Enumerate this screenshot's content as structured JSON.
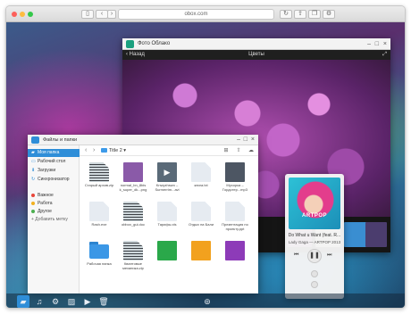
{
  "browser": {
    "url": "obox.com"
  },
  "photo_window": {
    "title": "Фото Облако",
    "back_label": "Назад",
    "folder": "Цветы",
    "thumb_colors": [
      "#a84ea8",
      "#d8c9c2",
      "#3a8ed1",
      "#4b3d6e",
      "#c06fc0"
    ]
  },
  "music": {
    "album_word": "ARTPOP",
    "song": "Do What u Want (feat. R...",
    "artist": "Lady Gaga — ARTPOP 2013"
  },
  "files_window": {
    "title": "Файлы и папки",
    "current_folder": "Title 2",
    "sidebar": [
      {
        "label": "Моя папка",
        "icon": "folder-icon",
        "active": true
      },
      {
        "label": "Рабочий стол",
        "icon": "desktop-icon",
        "active": false
      },
      {
        "label": "Загрузки",
        "icon": "download-icon",
        "active": false
      },
      {
        "label": "Синхронизатор",
        "icon": "sync-icon",
        "active": false
      }
    ],
    "tags": [
      {
        "label": "Важное",
        "color": "#e8463a"
      },
      {
        "label": "Работа",
        "color": "#f2b01e"
      },
      {
        "label": "Другое",
        "color": "#4caf50"
      }
    ],
    "add_tag_label": "+ Добавить метку",
    "files": [
      {
        "name": "Старый архив.zip",
        "kind": "archive",
        "color": "#cfd8dc"
      },
      {
        "name": "normal_bn_8bis k_super_dk...png",
        "kind": "image",
        "color": "#8a5aa8"
      },
      {
        "name": "Knwyzhswn – Surmerrim...avi",
        "kind": "video",
        "color": "#5a6a78"
      },
      {
        "name": "книга.txt",
        "kind": "doc",
        "color": "#e6ebf1"
      },
      {
        "name": "Мусорка – Гордстер...mp3",
        "kind": "photo",
        "color": "#4d5663"
      },
      {
        "name": "Rash.exe",
        "kind": "doc",
        "color": "#e6ebf1"
      },
      {
        "name": "obbox_gui.doc",
        "kind": "archive",
        "color": "#cfd8dc"
      },
      {
        "name": "Тарифы.xls",
        "kind": "doc",
        "color": "#e6ebf1"
      },
      {
        "name": "Отдых на Бали",
        "kind": "doc",
        "color": "#e6ebf1"
      },
      {
        "name": "Презентация по проекту.ppt",
        "kind": "doc",
        "color": "#e6ebf1"
      },
      {
        "name": "Рабочая папка",
        "kind": "folder",
        "color": "#3b97e6"
      },
      {
        "name": "Квантовые механика.zip",
        "kind": "archive",
        "color": "#cfd8dc"
      },
      {
        "name": "",
        "kind": "app",
        "color": "#2aa84a"
      },
      {
        "name": "",
        "kind": "app",
        "color": "#f2a11e"
      },
      {
        "name": "",
        "kind": "app",
        "color": "#8d3bb8"
      }
    ]
  },
  "dock": {
    "items": [
      "folder-icon",
      "music-icon",
      "settings-icon",
      "photo-icon",
      "video-icon",
      "trash-icon",
      "obox-icon"
    ]
  }
}
